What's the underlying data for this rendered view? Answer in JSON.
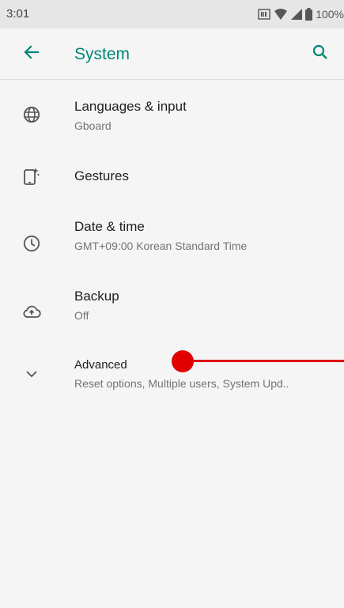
{
  "status_bar": {
    "time": "3:01",
    "battery": "100%"
  },
  "app_bar": {
    "title": "System",
    "back_icon": "arrow-back-icon",
    "search_icon": "search-icon"
  },
  "items": [
    {
      "title": "Languages & input",
      "subtitle": "Gboard",
      "icon": "globe-icon"
    },
    {
      "title": "Gestures",
      "subtitle": "",
      "icon": "gestures-icon"
    },
    {
      "title": "Date & time",
      "subtitle": "GMT+09:00 Korean Standard Time",
      "icon": "clock-icon"
    },
    {
      "title": "Backup",
      "subtitle": "Off",
      "icon": "cloud-backup-icon"
    },
    {
      "title": "Advanced",
      "subtitle": "Reset options, Multiple users, System Upd..",
      "icon": "chevron-down-icon"
    }
  ],
  "colors": {
    "accent": "#008577",
    "marker": "#e00000"
  }
}
